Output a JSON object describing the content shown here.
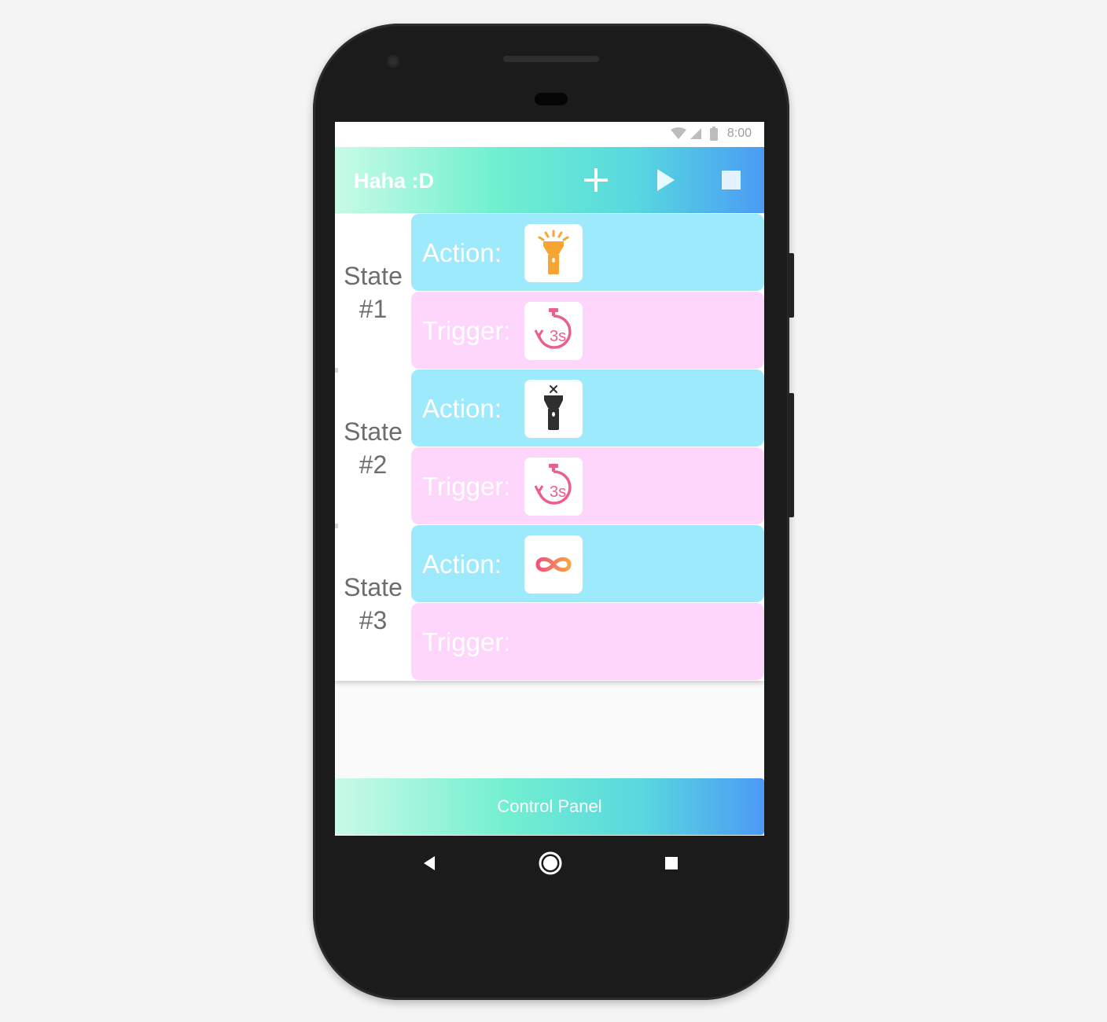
{
  "status_bar": {
    "time": "8:00"
  },
  "appbar": {
    "title": "Haha :D",
    "actions": [
      {
        "icon": "plus-icon"
      },
      {
        "icon": "play-icon"
      },
      {
        "icon": "stop-icon"
      }
    ]
  },
  "states": [
    {
      "label_line1": "State",
      "label_line2": "#1",
      "action_label": "Action:",
      "action_icon": "flashlight-on-icon",
      "trigger_label": "Trigger:",
      "trigger_icon": "timer-3s-icon",
      "trigger_icon_text": "3s"
    },
    {
      "label_line1": "State",
      "label_line2": "#2",
      "action_label": "Action:",
      "action_icon": "flashlight-off-icon",
      "trigger_label": "Trigger:",
      "trigger_icon": "timer-3s-icon",
      "trigger_icon_text": "3s"
    },
    {
      "label_line1": "State",
      "label_line2": "#3",
      "action_label": "Action:",
      "action_icon": "loop-infinity-icon",
      "trigger_label": "Trigger:",
      "trigger_icon": ""
    }
  ],
  "control_panel": {
    "label": "Control Panel"
  },
  "nav": {
    "buttons": [
      "back-icon",
      "home-icon",
      "recents-icon"
    ]
  },
  "colors": {
    "action_row": "#9deafc",
    "trigger_row": "#fed5fb",
    "flashlight_on": "#f7a432",
    "timer": "#ec5e8f",
    "infinity_start": "#f0527e",
    "infinity_end": "#f9a33f"
  }
}
